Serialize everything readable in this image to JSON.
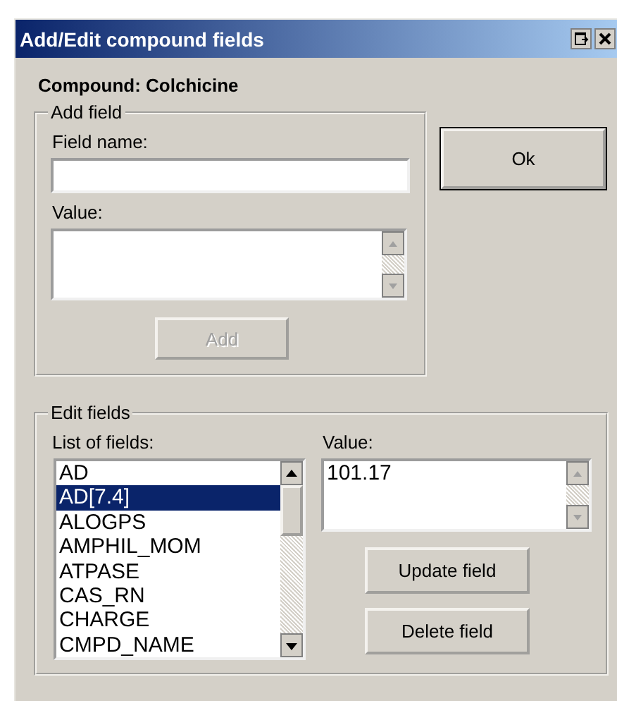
{
  "window": {
    "title": "Add/Edit compound fields"
  },
  "compound_label": "Compound: Colchicine",
  "ok_button": "Ok",
  "add_field": {
    "legend": "Add field",
    "field_name_label": "Field name:",
    "value_label": "Value:",
    "add_button": {
      "label": "Add",
      "disabled": true
    }
  },
  "edit_fields": {
    "legend": "Edit fields",
    "list_label": "List of fields:",
    "value_label": "Value:",
    "value": "101.17",
    "fields": [
      {
        "name": "AD",
        "selected": false
      },
      {
        "name": "AD[7.4]",
        "selected": true
      },
      {
        "name": "ALOGPS",
        "selected": false
      },
      {
        "name": "AMPHIL_MOM",
        "selected": false
      },
      {
        "name": "ATPASE",
        "selected": false
      },
      {
        "name": "CAS_RN",
        "selected": false
      },
      {
        "name": "CHARGE",
        "selected": false
      },
      {
        "name": "CMPD_NAME",
        "selected": false
      }
    ],
    "update_button": "Update field",
    "delete_button": "Delete field"
  }
}
